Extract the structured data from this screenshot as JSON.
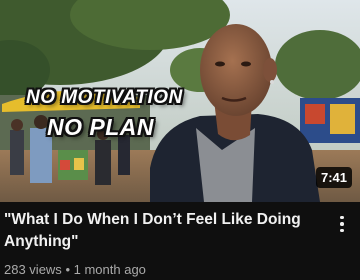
{
  "video": {
    "overlay_line_1": "NO MOTIVATION",
    "overlay_line_2": "NO PLAN",
    "duration": "7:41",
    "title": "\"What I Do When I Don’t Feel Like Doing Anything\"",
    "views": "283 views",
    "separator": "•",
    "age": "1 month ago"
  },
  "icons": {
    "more": "more-vert-icon"
  }
}
